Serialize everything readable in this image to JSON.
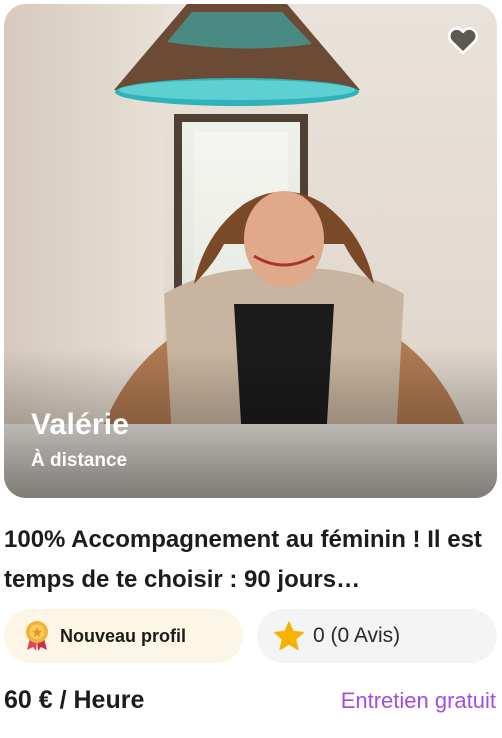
{
  "profile": {
    "name": "Valérie",
    "location": "À distance",
    "title": "100% Accompagnement au féminin ! Il est temps de te choisir : 90 jours…",
    "favorite_icon": "heart-icon"
  },
  "badges": {
    "new_profile_label": "Nouveau profil",
    "new_profile_icon": "award-ribbon-icon",
    "rating_label": "0 (0 Avis)",
    "rating_icon": "star-icon",
    "rating_icon_color": "#f5b300"
  },
  "pricing": {
    "price_label": "60 € / Heure",
    "free_session_label": "Entretien gratuit",
    "free_session_color": "#a14ee3"
  }
}
